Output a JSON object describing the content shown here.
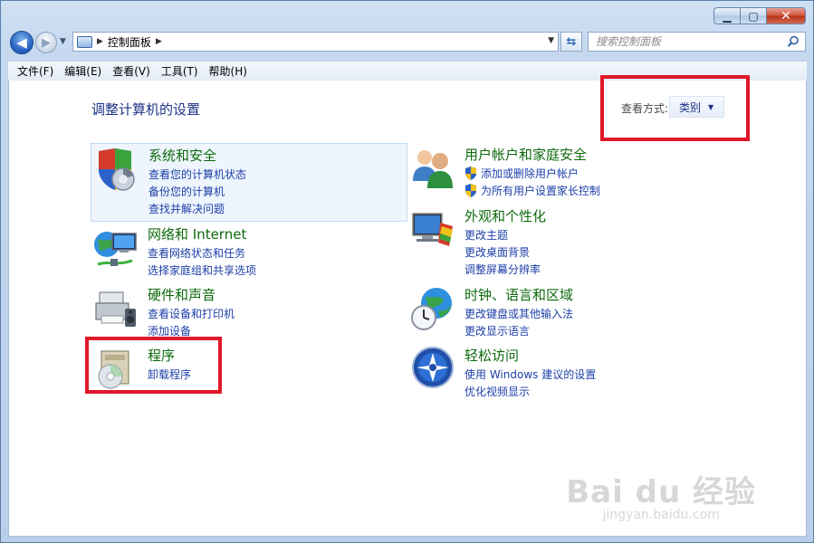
{
  "window": {
    "minimize": "▁",
    "maximize": "▢",
    "close": "✕"
  },
  "nav": {
    "breadcrumb": "控制面板",
    "search_placeholder": "搜索控制面板"
  },
  "menu": [
    "文件(F)",
    "编辑(E)",
    "查看(V)",
    "工具(T)",
    "帮助(H)"
  ],
  "page": {
    "title": "调整计算机的设置",
    "view_by_label": "查看方式:",
    "view_by_value": "类别"
  },
  "categories": [
    {
      "title": "系统和安全",
      "icon": "system-security-icon",
      "links": [
        "查看您的计算机状态",
        "备份您的计算机",
        "查找并解决问题"
      ]
    },
    {
      "title": "用户帐户和家庭安全",
      "icon": "user-accounts-icon",
      "links": [
        "添加或删除用户帐户",
        "为所有用户设置家长控制"
      ]
    },
    {
      "title": "网络和 Internet",
      "icon": "network-icon",
      "links": [
        "查看网络状态和任务",
        "选择家庭组和共享选项"
      ]
    },
    {
      "title": "外观和个性化",
      "icon": "appearance-icon",
      "links": [
        "更改主题",
        "更改桌面背景",
        "调整屏幕分辨率"
      ]
    },
    {
      "title": "硬件和声音",
      "icon": "hardware-sound-icon",
      "links": [
        "查看设备和打印机",
        "添加设备"
      ]
    },
    {
      "title": "时钟、语言和区域",
      "icon": "clock-globe-icon",
      "links": [
        "更改键盘或其他输入法",
        "更改显示语言"
      ]
    },
    {
      "title": "程序",
      "icon": "programs-icon",
      "links": [
        "卸载程序"
      ]
    },
    {
      "title": "轻松访问",
      "icon": "ease-of-access-icon",
      "links": [
        "使用 Windows 建议的设置",
        "优化视频显示"
      ]
    }
  ],
  "watermark": {
    "main": "Bai du 经验",
    "sub": "jingyan.baidu.com"
  },
  "colors": {
    "title_blue": "#1e3287",
    "category_green": "#0d6a0d",
    "link_blue": "#1c3fa8",
    "annotation_red": "#e0182a"
  }
}
